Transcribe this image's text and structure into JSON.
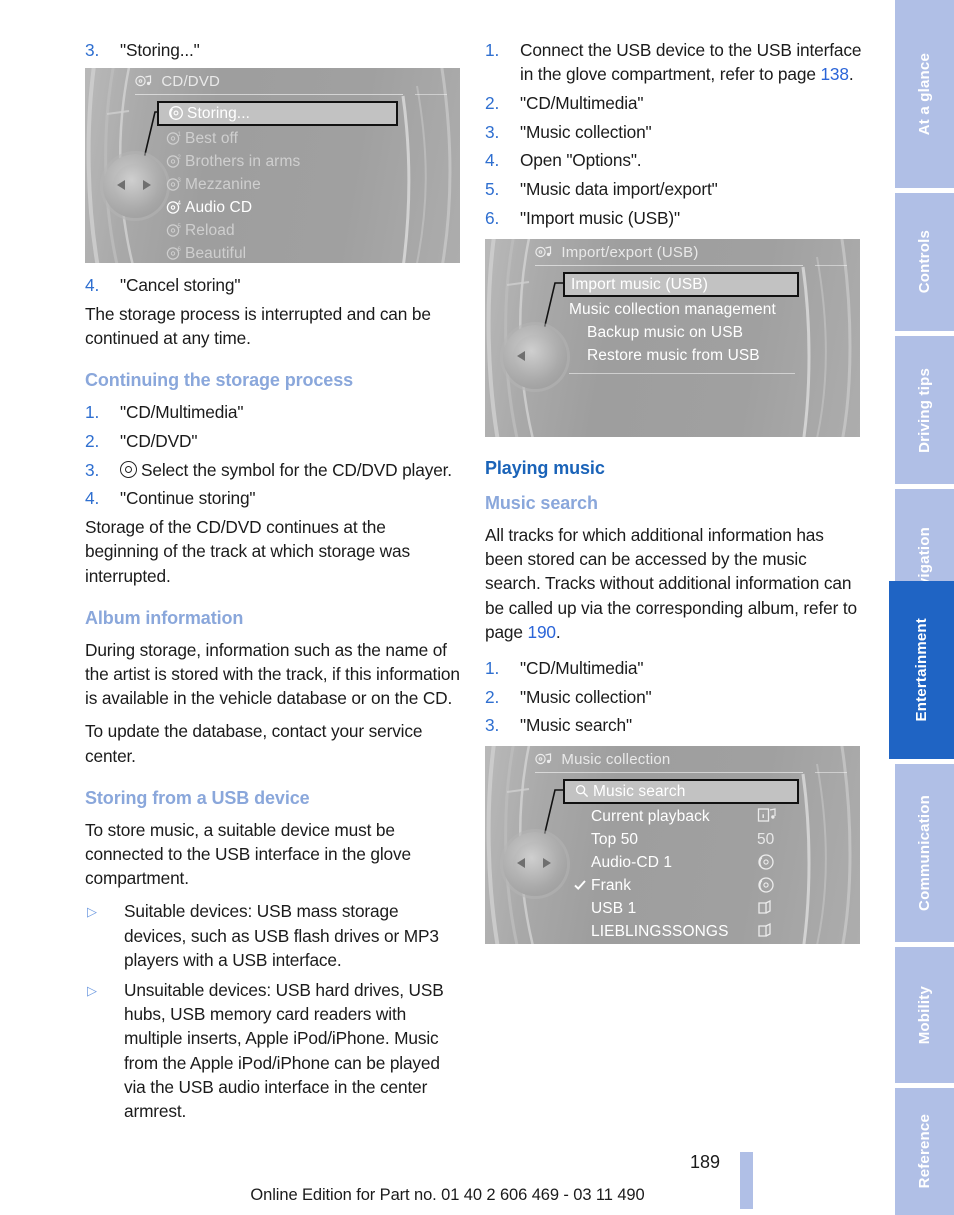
{
  "document": {
    "page_number": "189",
    "footer": "Online Edition for Part no. 01 40 2 606 469 - 03 11 490"
  },
  "sidebar": {
    "tabs": [
      {
        "label": "At a glance",
        "active": false
      },
      {
        "label": "Controls",
        "active": false
      },
      {
        "label": "Driving tips",
        "active": false
      },
      {
        "label": "Navigation",
        "active": false
      },
      {
        "label": "Entertainment",
        "active": true
      },
      {
        "label": "Communication",
        "active": false
      },
      {
        "label": "Mobility",
        "active": false
      },
      {
        "label": "Reference",
        "active": false
      }
    ]
  },
  "left_column": {
    "step3": {
      "num": "3.",
      "text": "\"Storing...\""
    },
    "display_cd_dvd": {
      "header": "CD/DVD",
      "header_icon": "cd-note-icon",
      "items": [
        {
          "label": "Storing...",
          "icon": "disc-icon",
          "state": "selected"
        },
        {
          "label": "Best off",
          "icon": "disc-1-icon",
          "state": "dim"
        },
        {
          "label": "Brothers in arms",
          "icon": "disc-2-icon",
          "state": "dim"
        },
        {
          "label": "Mezzanine",
          "icon": "disc-3-icon",
          "state": "dim"
        },
        {
          "label": "Audio CD",
          "icon": "disc-4-icon",
          "state": "bright"
        },
        {
          "label": "Reload",
          "icon": "disc-5-icon",
          "state": "dim"
        },
        {
          "label": "Beautiful",
          "icon": "disc-6-icon",
          "state": "dim"
        }
      ],
      "icon_superscripts": [
        "",
        "1",
        "2",
        "3",
        "4",
        "5",
        "6"
      ]
    },
    "step4": {
      "num": "4.",
      "text": "\"Cancel storing\""
    },
    "para_interrupted": "The storage process is interrupted and can be continued at any time.",
    "heading_continuing": "Continuing the storage process",
    "continuing_steps": [
      {
        "num": "1.",
        "text": "\"CD/Multimedia\""
      },
      {
        "num": "2.",
        "text": "\"CD/DVD\""
      },
      {
        "num": "3.",
        "text": "Select the symbol for the CD/DVD player.",
        "icon": "disc-icon"
      },
      {
        "num": "4.",
        "text": "\"Continue storing\""
      }
    ],
    "para_continues": "Storage of the CD/DVD continues at the beginning of the track at which storage was interrupted.",
    "heading_album": "Album information",
    "para_album_1": "During storage, information such as the name of the artist is stored with the track, if this information is available in the vehicle database or on the CD.",
    "para_album_2": "To update the database, contact your service center.",
    "heading_usb": "Storing from a USB device",
    "para_usb": "To store music, a suitable device must be connected to the USB interface in the glove compartment.",
    "usb_bullets": [
      "Suitable devices: USB mass storage devices, such as USB flash drives or MP3 players with a USB interface.",
      "Unsuitable devices: USB hard drives, USB hubs, USB memory card readers with multiple inserts, Apple iPod/iPhone. Music from the Apple iPod/iPhone can be played via the USB audio interface in the center armrest."
    ]
  },
  "right_column": {
    "usb_steps": [
      {
        "num": "1.",
        "text": "Connect the USB device to the USB interface in the glove compartment, refer to page ",
        "page_ref": "138",
        "suffix": "."
      },
      {
        "num": "2.",
        "text": "\"CD/Multimedia\""
      },
      {
        "num": "3.",
        "text": "\"Music collection\""
      },
      {
        "num": "4.",
        "text": "Open \"Options\"."
      },
      {
        "num": "5.",
        "text": "\"Music data import/export\""
      },
      {
        "num": "6.",
        "text": "\"Import music (USB)\""
      }
    ],
    "display_import": {
      "header": "Import/export (USB)",
      "header_icon": "cd-note-plus-icon",
      "items": [
        {
          "label": "Import music (USB)",
          "state": "selected"
        },
        {
          "label": "Music collection management",
          "state": "bright"
        },
        {
          "label": "Backup music on USB",
          "state": "bright",
          "indent": true
        },
        {
          "label": "Restore music from USB",
          "state": "bright",
          "indent": true
        }
      ]
    },
    "heading_playing": "Playing music",
    "heading_search": "Music search",
    "para_search": "All tracks for which additional information has been stored can be accessed by the music search. Tracks without additional information can be called up via the corresponding album, refer to page ",
    "para_search_ref": "190",
    "para_search_suffix": ".",
    "search_steps": [
      {
        "num": "1.",
        "text": "\"CD/Multimedia\""
      },
      {
        "num": "2.",
        "text": "\"Music collection\""
      },
      {
        "num": "3.",
        "text": "\"Music search\""
      }
    ],
    "display_collection": {
      "header": "Music collection",
      "header_icon": "cd-note-icon",
      "items": [
        {
          "label": "Music search",
          "state": "selected",
          "left_icon": "magnifier-icon",
          "right_icon": ""
        },
        {
          "label": "Current playback",
          "state": "bright",
          "left_icon": "",
          "right_icon": "info-note-icon"
        },
        {
          "label": "Top 50",
          "state": "bright",
          "left_icon": "",
          "right_icon": "50"
        },
        {
          "label": "Audio-CD 1",
          "state": "bright",
          "left_icon": "",
          "right_icon": "disc-icon"
        },
        {
          "label": "Frank",
          "state": "bright",
          "left_icon": "check-icon",
          "right_icon": "disc-icon"
        },
        {
          "label": "USB 1",
          "state": "bright",
          "left_icon": "",
          "right_icon": "folder-icon"
        },
        {
          "label": "LIEBLINGSSONGS",
          "state": "bright",
          "left_icon": "",
          "right_icon": "folder-icon"
        }
      ]
    }
  },
  "colors": {
    "heading_primary": "#1a63b8",
    "heading_secondary": "#8aa7db",
    "step_number": "#2f6fd0",
    "page_ref": "#2a64d8",
    "tab_inactive": "#b0bfe6",
    "tab_active": "#1f64c4",
    "body_text": "#1b1b1b"
  }
}
